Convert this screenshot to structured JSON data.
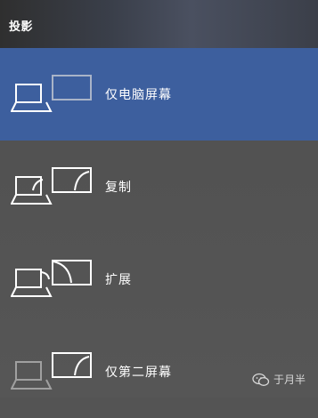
{
  "header": {
    "title": "投影"
  },
  "options": [
    {
      "label": "仅电脑屏幕",
      "selected": true
    },
    {
      "label": "复制",
      "selected": false
    },
    {
      "label": "扩展",
      "selected": false
    },
    {
      "label": "仅第二屏幕",
      "selected": false
    }
  ],
  "watermark": {
    "text": "于月半"
  },
  "colors": {
    "selected_bg": "#3d5f9e",
    "panel_bg": "#545454",
    "icon_active": "#ffffff",
    "icon_dim": "#a9b4c8",
    "icon_gray": "#a0a0a0"
  }
}
